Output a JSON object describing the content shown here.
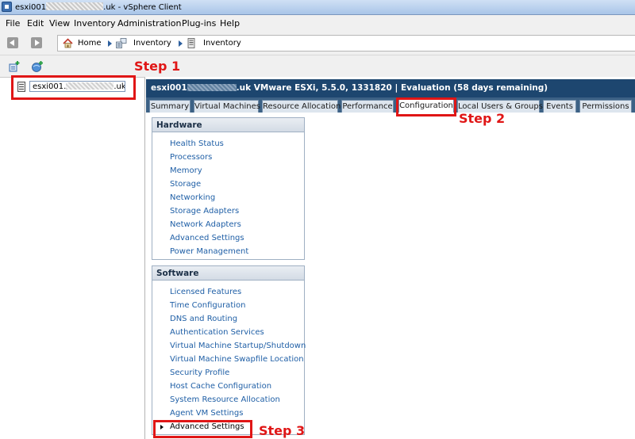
{
  "window": {
    "title_prefix": "esxi001",
    "title_suffix": ".uk - vSphere Client"
  },
  "menu": [
    "File",
    "Edit",
    "View",
    "Inventory",
    "Administration",
    "Plug-ins",
    "Help"
  ],
  "breadcrumb": {
    "home": "Home",
    "inventory_1": "Inventory",
    "inventory_2": "Inventory"
  },
  "tree": {
    "host_prefix": "esxi001.",
    "host_suffix": ".uk"
  },
  "host_header": {
    "name_prefix": "esxi001",
    "details": ".uk VMware ESXi, 5.5.0, 1331820 | Evaluation (58 days remaining)"
  },
  "tabs": [
    {
      "label": "Summary"
    },
    {
      "label": "Virtual Machines"
    },
    {
      "label": "Resource Allocation"
    },
    {
      "label": "Performance"
    },
    {
      "label": "Configuration"
    },
    {
      "label": "Local Users & Groups"
    },
    {
      "label": "Events"
    },
    {
      "label": "Permissions"
    }
  ],
  "hardware": {
    "title": "Hardware",
    "items": [
      "Health Status",
      "Processors",
      "Memory",
      "Storage",
      "Networking",
      "Storage Adapters",
      "Network Adapters",
      "Advanced Settings",
      "Power Management"
    ]
  },
  "software": {
    "title": "Software",
    "items": [
      "Licensed Features",
      "Time Configuration",
      "DNS and Routing",
      "Authentication Services",
      "Virtual Machine Startup/Shutdown",
      "Virtual Machine Swapfile Location",
      "Security Profile",
      "Host Cache Configuration",
      "System Resource Allocation",
      "Agent VM Settings",
      "Advanced Settings"
    ]
  },
  "annotations": {
    "step1": "Step 1",
    "step2": "Step 2",
    "step3": "Step 3",
    "color": "#e01616"
  },
  "colors": {
    "header_bg": "#1d466f",
    "link": "#1f5fa6"
  }
}
